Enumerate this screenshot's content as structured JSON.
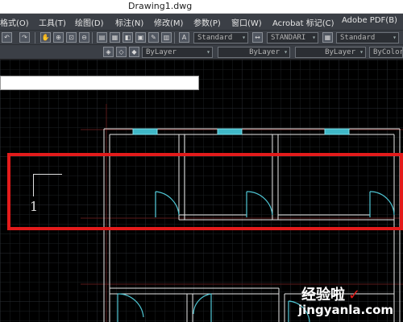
{
  "window": {
    "title": "Drawing1.dwg"
  },
  "menu": {
    "items": [
      "格式(O)",
      "工具(T)",
      "绘图(D)",
      "标注(N)",
      "修改(M)",
      "参数(P)",
      "窗口(W)",
      "Acrobat 标记(C)",
      "Adobe PDF(B)"
    ]
  },
  "styles": {
    "text_style": "Standard",
    "dim_style": "STANDARI",
    "table_style": "Standard"
  },
  "properties": {
    "layer": "ByLayer",
    "linetype": "ByLayer",
    "lineweight": "ByLayer",
    "color": "ByColor"
  },
  "ucs": {
    "label": "1"
  },
  "watermark": {
    "cn": "经验啦",
    "check": "✓",
    "en": "jingyanla.com"
  },
  "colors": {
    "highlight": "#e31b1b",
    "wall": "#e8e8e8",
    "window": "#3fb8c8",
    "door": "#4fc6d4"
  }
}
